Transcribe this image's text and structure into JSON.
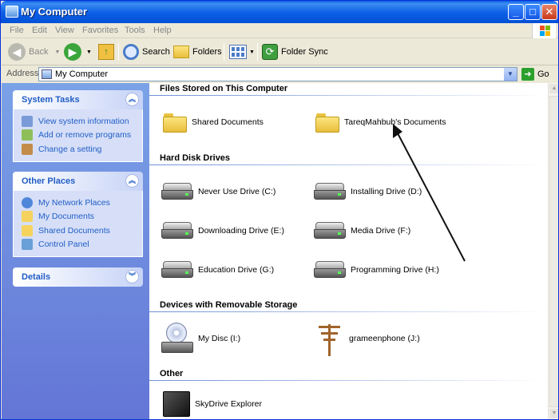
{
  "window": {
    "title": "My Computer"
  },
  "title_buttons": {
    "minimize": "_",
    "maximize": "□",
    "close": "✕"
  },
  "menu": [
    "File",
    "Edit",
    "View",
    "Favorites",
    "Tools",
    "Help"
  ],
  "toolbar": {
    "back": "Back",
    "search": "Search",
    "folders": "Folders",
    "folder_sync": "Folder Sync"
  },
  "address": {
    "label": "Address",
    "value": "My Computer",
    "go": "Go"
  },
  "tasks": {
    "system_tasks": {
      "title": "System Tasks",
      "items": [
        "View system information",
        "Add or remove programs",
        "Change a setting"
      ]
    },
    "other_places": {
      "title": "Other Places",
      "items": [
        "My Network Places",
        "My Documents",
        "Shared Documents",
        "Control Panel"
      ]
    },
    "details": {
      "title": "Details"
    }
  },
  "groups": {
    "files": {
      "title": "Files Stored on This Computer",
      "items": [
        "Shared Documents",
        "TareqMahbub's Documents"
      ]
    },
    "drives": {
      "title": "Hard Disk Drives",
      "items": [
        "Never Use Drive (C:)",
        "Installing Drive (D:)",
        "Downloading Drive (E:)",
        "Media Drive (F:)",
        "Education Drive (G:)",
        "Programming Drive (H:)"
      ]
    },
    "removable": {
      "title": "Devices with Removable Storage",
      "items": [
        "My Disc (I:)",
        "grameenphone (J:)"
      ]
    },
    "other": {
      "title": "Other",
      "items": [
        "SkyDrive Explorer"
      ]
    }
  },
  "colors": {
    "title_bar": "#0b5fe5",
    "task_pane": "#7ba2e7",
    "link": "#215dc6",
    "folder": "#f5d35e"
  }
}
